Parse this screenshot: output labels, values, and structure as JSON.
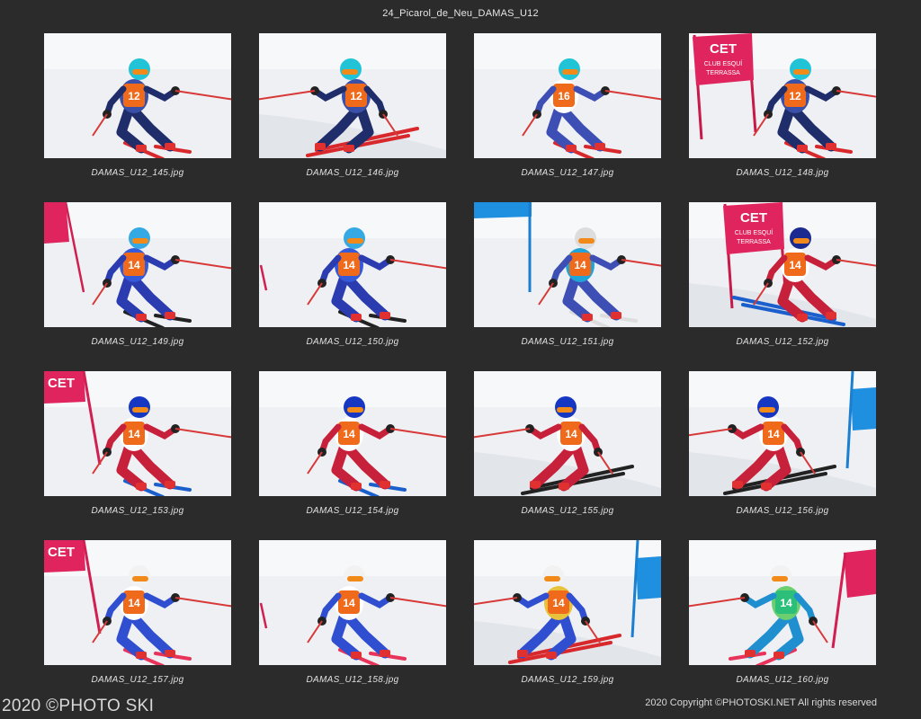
{
  "sheet": {
    "title": "24_Picarol_de_Neu_DAMAS_U12"
  },
  "photos": [
    {
      "filename": "DAMAS_U12_145.jpg",
      "bib": "12",
      "helmet": "#21c4d6",
      "bibColor": "#f06a1c",
      "suit": [
        "#1f2d6b",
        "#3a4fa8"
      ],
      "skis": "#d8282c",
      "gate": null,
      "pose": 0,
      "flip": false
    },
    {
      "filename": "DAMAS_U12_146.jpg",
      "bib": "12",
      "helmet": "#21c4d6",
      "bibColor": "#f06a1c",
      "suit": [
        "#1f2d6b",
        "#3a4fa8"
      ],
      "skis": "#d8282c",
      "gate": null,
      "pose": 1,
      "flip": true
    },
    {
      "filename": "DAMAS_U12_147.jpg",
      "bib": "16",
      "helmet": "#21c4d6",
      "bibColor": "#f06a1c",
      "suit": [
        "#3d4fb5",
        "#ffffff"
      ],
      "skis": "#d8282c",
      "gate": null,
      "pose": 2,
      "flip": false
    },
    {
      "filename": "DAMAS_U12_148.jpg",
      "bib": "12",
      "helmet": "#21c4d6",
      "bibColor": "#f06a1c",
      "suit": [
        "#1f2d6b",
        "#3a4fa8"
      ],
      "skis": "#d8282c",
      "gate": "pink-left",
      "pose": 0,
      "flip": false
    },
    {
      "filename": "DAMAS_U12_149.jpg",
      "bib": "14",
      "helmet": "#35a9e3",
      "bibColor": "#f06a1c",
      "suit": [
        "#2a3cb0",
        "#3459d9"
      ],
      "skis": "#222222",
      "gate": "pink-edge",
      "pose": 0,
      "flip": false
    },
    {
      "filename": "DAMAS_U12_150.jpg",
      "bib": "14",
      "helmet": "#35a9e3",
      "bibColor": "#f06a1c",
      "suit": [
        "#2a3cb0",
        "#3459d9"
      ],
      "skis": "#222222",
      "gate": "pink-edge-small",
      "pose": 0,
      "flip": false
    },
    {
      "filename": "DAMAS_U12_151.jpg",
      "bib": "14",
      "helmet": "#dddddd",
      "bibColor": "#f06a1c",
      "suit": [
        "#3d4fb5",
        "#22a3d8"
      ],
      "skis": "#dddddd",
      "gate": "blue-left",
      "pose": 2,
      "flip": false
    },
    {
      "filename": "DAMAS_U12_152.jpg",
      "bib": "14",
      "helmet": "#1a2a90",
      "bibColor": "#f06a1c",
      "suit": [
        "#c7203a",
        "#ffffff"
      ],
      "skis": "#1a5fcc",
      "gate": "pink-center",
      "pose": 1,
      "flip": false
    },
    {
      "filename": "DAMAS_U12_153.jpg",
      "bib": "14",
      "helmet": "#1537c2",
      "bibColor": "#f06a1c",
      "suit": [
        "#c7203a",
        "#ffffff"
      ],
      "skis": "#1a5fcc",
      "gate": "pink-top-left",
      "pose": 0,
      "flip": false
    },
    {
      "filename": "DAMAS_U12_154.jpg",
      "bib": "14",
      "helmet": "#1537c2",
      "bibColor": "#f06a1c",
      "suit": [
        "#c7203a",
        "#ffffff"
      ],
      "skis": "#1a5fcc",
      "gate": null,
      "pose": 0,
      "flip": false
    },
    {
      "filename": "DAMAS_U12_155.jpg",
      "bib": "14",
      "helmet": "#1537c2",
      "bibColor": "#f06a1c",
      "suit": [
        "#c7203a",
        "#ffffff"
      ],
      "skis": "#222222",
      "gate": null,
      "pose": 1,
      "flip": true
    },
    {
      "filename": "DAMAS_U12_156.jpg",
      "bib": "14",
      "helmet": "#1537c2",
      "bibColor": "#f06a1c",
      "suit": [
        "#c7203a",
        "#ffffff"
      ],
      "skis": "#222222",
      "gate": "blue-right",
      "pose": 1,
      "flip": true
    },
    {
      "filename": "DAMAS_U12_157.jpg",
      "bib": "14",
      "helmet": "#f2f2f2",
      "bibColor": "#f06a1c",
      "suit": [
        "#2f4fd0",
        "#ffffff"
      ],
      "skis": "#e8335a",
      "gate": "pink-top-left",
      "pose": 0,
      "flip": false
    },
    {
      "filename": "DAMAS_U12_158.jpg",
      "bib": "14",
      "helmet": "#f2f2f2",
      "bibColor": "#f06a1c",
      "suit": [
        "#2f4fd0",
        "#ffffff"
      ],
      "skis": "#e8335a",
      "gate": "pink-edge-small",
      "pose": 0,
      "flip": false
    },
    {
      "filename": "DAMAS_U12_159.jpg",
      "bib": "14",
      "helmet": "#f2f2f2",
      "bibColor": "#f06a1c",
      "suit": [
        "#2f4fd0",
        "#e8c23a"
      ],
      "skis": "#d8282c",
      "gate": "blue-right",
      "pose": 1,
      "flip": true
    },
    {
      "filename": "DAMAS_U12_160.jpg",
      "bib": "14",
      "helmet": "#f2f2f2",
      "bibColor": "#2bbf7a",
      "suit": [
        "#1f8fd0",
        "#6ccf6f"
      ],
      "skis": "#e8335a",
      "gate": "pink-right",
      "pose": 2,
      "flip": true
    }
  ],
  "gate_text": {
    "line1": "CET",
    "line2": "CLUB ESQUÍ",
    "line3": "TERRASSA"
  },
  "footer": {
    "watermark": "2020 ©PHOTO SKI",
    "copyright": "2020 Copyright ©PHOTOSKI.NET All rights reserved"
  },
  "colors": {
    "background": "#2b2b2b",
    "snow": "#eef0f3",
    "gate_pink": "#e0245e",
    "gate_blue": "#1f8fe0"
  }
}
